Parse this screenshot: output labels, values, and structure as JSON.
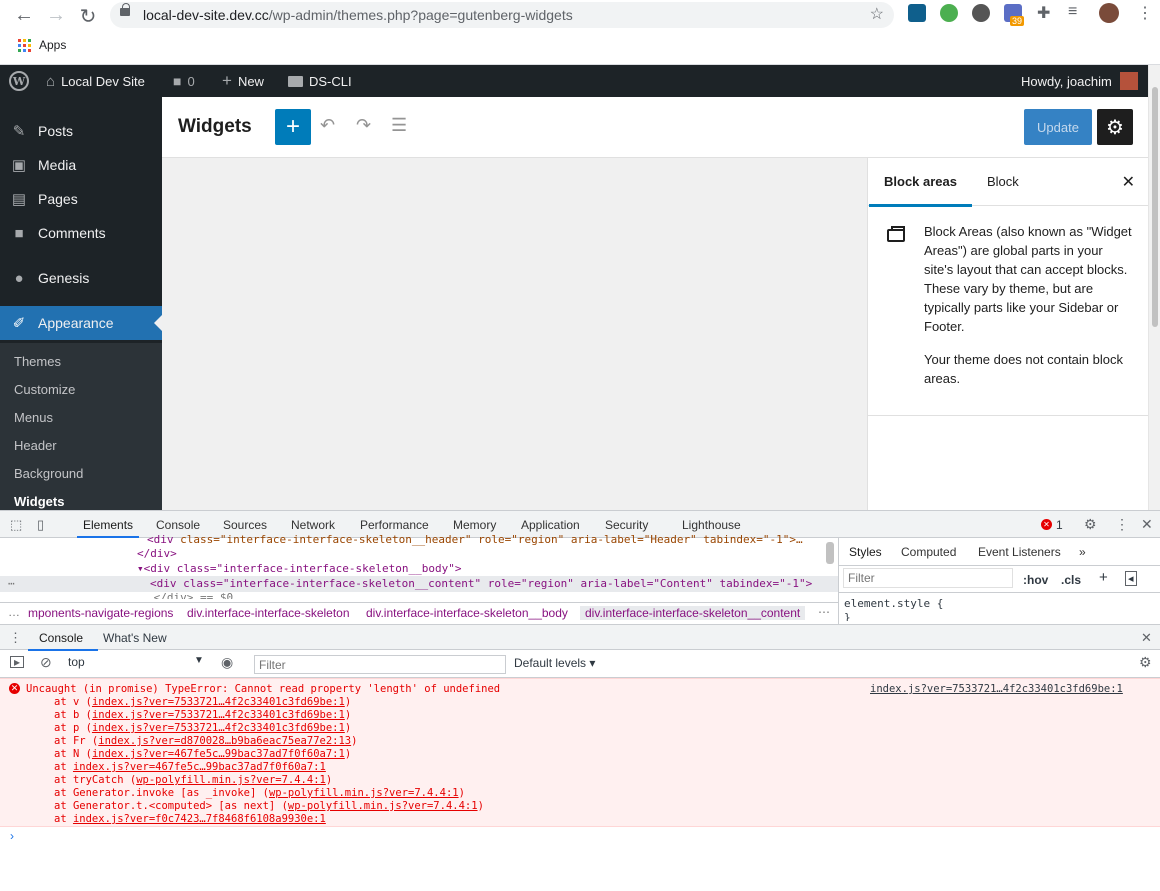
{
  "browser": {
    "url_host": "local-dev-site.dev.cc",
    "url_path": "/wp-admin/themes.php?page=gutenberg-widgets",
    "bookmarks": {
      "apps_label": "Apps"
    },
    "extension_badge": "39"
  },
  "adminbar": {
    "site_name": "Local Dev Site",
    "comments_count": "0",
    "new_label": "New",
    "dscli_label": "DS-CLI",
    "howdy": "Howdy, joachim"
  },
  "sidebar": {
    "items": [
      {
        "label": "Posts",
        "icon": "pin-icon"
      },
      {
        "label": "Media",
        "icon": "media-icon"
      },
      {
        "label": "Pages",
        "icon": "pages-icon"
      },
      {
        "label": "Comments",
        "icon": "comments-icon"
      },
      {
        "label": "Genesis",
        "icon": "genesis-icon"
      },
      {
        "label": "Appearance",
        "icon": "brush-icon"
      }
    ],
    "submenu": [
      "Themes",
      "Customize",
      "Menus",
      "Header",
      "Background",
      "Widgets"
    ]
  },
  "editor": {
    "title": "Widgets",
    "update_label": "Update",
    "accent": "#007cba"
  },
  "settings_panel": {
    "tab_block_areas": "Block areas",
    "tab_block": "Block",
    "description": "Block Areas (also known as \"Widget Areas\") are global parts in your site's layout that can accept blocks. These vary by theme, but are typically parts like your Sidebar or Footer.",
    "notice": "Your theme does not contain block areas."
  },
  "devtools": {
    "tabs": [
      "Elements",
      "Console",
      "Sources",
      "Network",
      "Performance",
      "Memory",
      "Application",
      "Security",
      "Lighthouse"
    ],
    "error_count": "1",
    "elements_lines": {
      "l1_prefix": "<div ",
      "l1": "class=\"interface-interface-skeleton__header\" role=\"region\" aria-label=\"Header\" tabindex=\"-1\">…",
      "l2": "</div>",
      "l3": "<div class=\"interface-interface-skeleton__body\">",
      "l4": "<div class=\"interface-interface-skeleton__content\" role=\"region\" aria-label=\"Content\" tabindex=\"-1\">",
      "l5": "…</div> == $0"
    },
    "breadcrumbs": [
      "mponents-navigate-regions",
      "div.interface-interface-skeleton",
      "div.interface-interface-skeleton__body",
      "div.interface-interface-skeleton__content"
    ],
    "styles_tabs": [
      "Styles",
      "Computed",
      "Event Listeners"
    ],
    "styles_filter_placeholder": "Filter",
    "hov": ":hov",
    "cls": ".cls",
    "element_style": "element.style {",
    "element_style_close": "}",
    "console_tabs": [
      "Console",
      "What's New"
    ],
    "context": "top",
    "console_filter_placeholder": "Filter",
    "levels": "Default levels ▾",
    "error": {
      "message": "Uncaught (in promise) TypeError: Cannot read property 'length' of undefined",
      "source": "index.js?ver=7533721…4f2c33401c3fd69be:1",
      "stack": [
        {
          "prefix": "at v (",
          "link": "index.js?ver=7533721…4f2c33401c3fd69be:1",
          "suffix": ")"
        },
        {
          "prefix": "at b (",
          "link": "index.js?ver=7533721…4f2c33401c3fd69be:1",
          "suffix": ")"
        },
        {
          "prefix": "at p (",
          "link": "index.js?ver=7533721…4f2c33401c3fd69be:1",
          "suffix": ")"
        },
        {
          "prefix": "at Fr (",
          "link": "index.js?ver=d870028…b9ba6eac75ea77e2:13",
          "suffix": ")"
        },
        {
          "prefix": "at N (",
          "link": "index.js?ver=467fe5c…99bac37ad7f0f60a7:1",
          "suffix": ")"
        },
        {
          "prefix": "at ",
          "link": "index.js?ver=467fe5c…99bac37ad7f0f60a7:1",
          "suffix": ""
        },
        {
          "prefix": "at tryCatch (",
          "link": "wp-polyfill.min.js?ver=7.4.4:1",
          "suffix": ")"
        },
        {
          "prefix": "at Generator.invoke [as _invoke] (",
          "link": "wp-polyfill.min.js?ver=7.4.4:1",
          "suffix": ")"
        },
        {
          "prefix": "at Generator.t.<computed> [as next] (",
          "link": "wp-polyfill.min.js?ver=7.4.4:1",
          "suffix": ")"
        },
        {
          "prefix": "at ",
          "link": "index.js?ver=f0c7423…7f8468f6108a9930e:1",
          "suffix": ""
        }
      ]
    }
  }
}
